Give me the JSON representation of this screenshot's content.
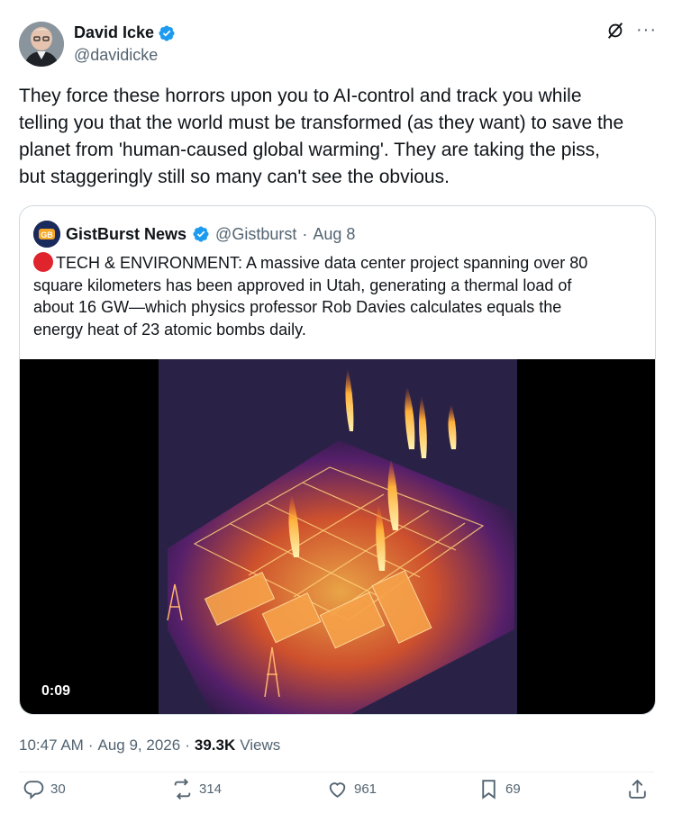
{
  "author": {
    "display_name": "David Icke",
    "handle": "@davidicke",
    "verified": true,
    "icons": [
      "verified-badge-icon",
      "grok-icon",
      "more-options-icon"
    ]
  },
  "more_label": "···",
  "tweet_text": "They force these horrors upon you to AI-control and track you while\ntelling you that the world must be transformed (as they want) to save the\nplanet from 'human-caused global warming'. They are taking the piss,\nbut staggeringly still so many can't see the obvious.",
  "quote": {
    "display_name": "GistBurst News",
    "handle": "@Gistburst",
    "separator": "·",
    "date": "Aug 8",
    "text": "TECH & ENVIRONMENT: A massive data center project spanning over 80\nsquare kilometers has been approved in Utah, generating a thermal load of\nabout 16 GW—which physics professor Rob Davies calculates equals the\nenergy heat of 23 atomic bombs daily.",
    "video_time": "0:09"
  },
  "meta": {
    "time": "10:47 AM",
    "separator": "·",
    "date": "Aug 9, 2026",
    "separator2": "·",
    "views_count": "39.3K",
    "views_label": "Views"
  },
  "actions": {
    "replies": "30",
    "reposts": "314",
    "likes": "961",
    "bookmarks": "69"
  },
  "colors": {
    "text": "#0f1419",
    "secondary": "#536471",
    "verified_blue": "#1d9bf0",
    "border": "#cfd9de"
  }
}
